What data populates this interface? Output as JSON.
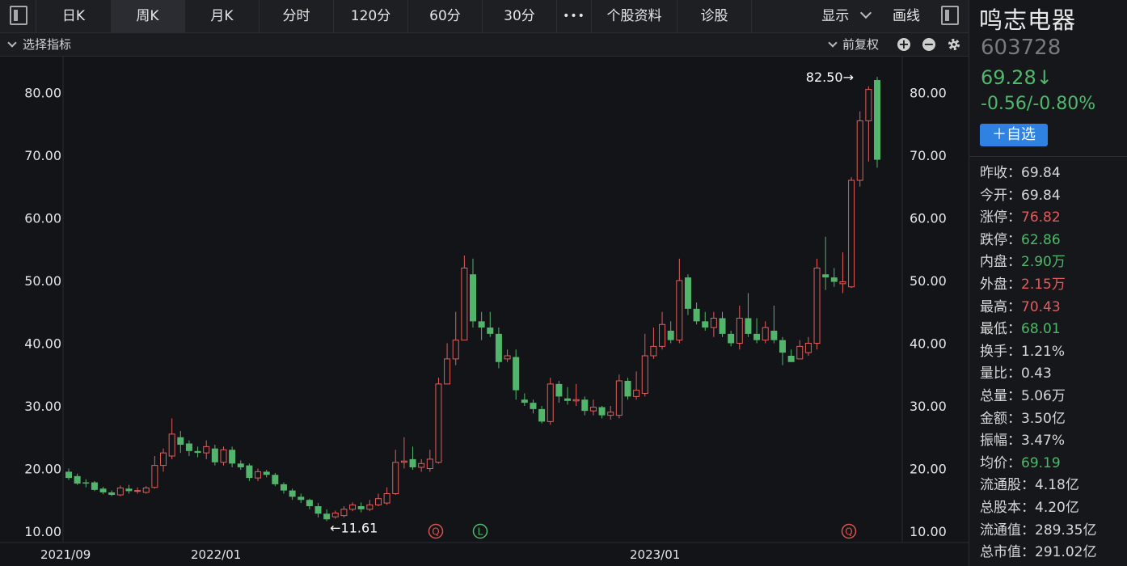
{
  "tabs": [
    {
      "label": "日K",
      "active": false
    },
    {
      "label": "周K",
      "active": true
    },
    {
      "label": "月K",
      "active": false
    },
    {
      "label": "分时",
      "active": false
    },
    {
      "label": "120分",
      "active": false
    },
    {
      "label": "60分",
      "active": false
    },
    {
      "label": "30分",
      "active": false
    },
    {
      "label": "•••",
      "active": false
    },
    {
      "label": "个股资料",
      "active": false
    },
    {
      "label": "诊股",
      "active": false
    }
  ],
  "toolbar": {
    "display_label": "显示",
    "draw_label": "画线"
  },
  "indicator_bar": {
    "select_label": "选择指标",
    "adjust_label": "前复权"
  },
  "colors": {
    "up": "#e25c5c",
    "down": "#52b56b",
    "accent": "#2f82e2",
    "background": "#131417"
  },
  "stock": {
    "name": "鸣志电器",
    "code": "603728",
    "price": "69.28↓",
    "change": "-0.56/-0.80%",
    "watch_label": "＋自选"
  },
  "stats": [
    {
      "label": "昨收：",
      "value": "69.84",
      "color": "#d8d8d8"
    },
    {
      "label": "今开：",
      "value": "69.84",
      "color": "#d8d8d8"
    },
    {
      "label": "涨停：",
      "value": "76.82",
      "color": "#e25c5c"
    },
    {
      "label": "跌停：",
      "value": "62.86",
      "color": "#4fb86b"
    },
    {
      "label": "内盘：",
      "value": "2.90万",
      "color": "#4fb86b"
    },
    {
      "label": "外盘：",
      "value": "2.15万",
      "color": "#e25c5c"
    },
    {
      "label": "最高：",
      "value": "70.43",
      "color": "#e25c5c"
    },
    {
      "label": "最低：",
      "value": "68.01",
      "color": "#4fb86b"
    },
    {
      "label": "换手：",
      "value": "1.21%",
      "color": "#d8d8d8"
    },
    {
      "label": "量比：",
      "value": "0.43",
      "color": "#d8d8d8"
    },
    {
      "label": "总量：",
      "value": "5.06万",
      "color": "#d8d8d8"
    },
    {
      "label": "金额：",
      "value": "3.50亿",
      "color": "#d8d8d8"
    },
    {
      "label": "振幅：",
      "value": "3.47%",
      "color": "#d8d8d8"
    },
    {
      "label": "均价：",
      "value": "69.19",
      "color": "#4fb86b"
    },
    {
      "label": "流通股：",
      "value": "4.18亿",
      "color": "#d8d8d8"
    },
    {
      "label": "总股本：",
      "value": "4.20亿",
      "color": "#d8d8d8"
    },
    {
      "label": "流通值：",
      "value": "289.35亿",
      "color": "#d8d8d8"
    },
    {
      "label": "总市值：",
      "value": "291.02亿",
      "color": "#d8d8d8"
    }
  ],
  "chart_data": {
    "type": "candlestick",
    "y_ticks": [
      "80.00",
      "70.00",
      "60.00",
      "50.00",
      "40.00",
      "30.00",
      "20.00",
      "10.00"
    ],
    "x_ticks": [
      "2021/09",
      "2022/01",
      "2023/01"
    ],
    "max_label": "82.50→",
    "min_label": "←11.61",
    "event_markers": [
      "Q",
      "L",
      "Q"
    ],
    "candles": [
      [
        19.5,
        18.5,
        20.0,
        18.2
      ],
      [
        18.8,
        17.6,
        19.2,
        17.4
      ],
      [
        17.8,
        17.6,
        18.3,
        17.0
      ],
      [
        17.8,
        16.6,
        18.0,
        16.4
      ],
      [
        16.8,
        16.2,
        17.1,
        15.9
      ],
      [
        16.2,
        15.8,
        16.5,
        15.6
      ],
      [
        15.8,
        16.9,
        17.3,
        15.6
      ],
      [
        16.8,
        16.4,
        17.4,
        16.0
      ],
      [
        16.5,
        16.5,
        17.0,
        16.0
      ],
      [
        16.2,
        16.9,
        17.2,
        16.0
      ],
      [
        17.0,
        20.5,
        22.0,
        16.8
      ],
      [
        20.5,
        22.5,
        23.2,
        19.5
      ],
      [
        22.0,
        25.5,
        28.0,
        21.5
      ],
      [
        25.0,
        23.8,
        26.0,
        22.5
      ],
      [
        24.0,
        22.8,
        24.5,
        22.0
      ],
      [
        22.8,
        22.5,
        23.5,
        21.8
      ],
      [
        22.5,
        23.5,
        24.5,
        21.5
      ],
      [
        23.2,
        21.0,
        23.8,
        20.5
      ],
      [
        21.0,
        23.0,
        23.5,
        20.5
      ],
      [
        23.0,
        20.8,
        23.5,
        20.2
      ],
      [
        20.8,
        20.2,
        21.3,
        19.8
      ],
      [
        20.5,
        18.5,
        20.8,
        18.0
      ],
      [
        18.5,
        19.5,
        20.0,
        18.0
      ],
      [
        19.5,
        19.0,
        19.8,
        18.6
      ],
      [
        19.0,
        17.5,
        19.3,
        17.2
      ],
      [
        17.5,
        16.5,
        17.8,
        16.0
      ],
      [
        16.5,
        15.5,
        16.8,
        15.0
      ],
      [
        15.5,
        15.0,
        16.0,
        14.5
      ],
      [
        15.0,
        14.0,
        15.2,
        13.5
      ],
      [
        14.0,
        12.8,
        14.5,
        12.2
      ],
      [
        12.8,
        11.9,
        13.5,
        11.61
      ],
      [
        12.3,
        12.9,
        13.3,
        12.0
      ],
      [
        12.5,
        13.5,
        14.0,
        12.2
      ],
      [
        13.5,
        14.2,
        14.6,
        13.2
      ],
      [
        14.0,
        13.5,
        14.6,
        13.0
      ],
      [
        13.5,
        14.2,
        15.0,
        13.2
      ],
      [
        14.2,
        15.2,
        16.0,
        14.0
      ],
      [
        14.5,
        16.0,
        17.0,
        14.2
      ],
      [
        16.0,
        21.0,
        23.0,
        15.8
      ],
      [
        21.0,
        21.2,
        25.0,
        20.0
      ],
      [
        21.5,
        20.2,
        23.5,
        19.8
      ],
      [
        20.2,
        20.8,
        21.5,
        19.5
      ],
      [
        20.0,
        21.5,
        23.0,
        19.5
      ],
      [
        21.0,
        33.5,
        34.5,
        20.8
      ],
      [
        33.5,
        37.5,
        40.0,
        33.5
      ],
      [
        37.5,
        40.5,
        45.0,
        36.5
      ],
      [
        40.5,
        52.0,
        54.0,
        40.5
      ],
      [
        51.0,
        43.5,
        53.5,
        42.5
      ],
      [
        43.5,
        42.5,
        45.0,
        40.5
      ],
      [
        42.5,
        41.5,
        45.0,
        41.0
      ],
      [
        41.5,
        37.0,
        42.5,
        36.0
      ],
      [
        37.5,
        38.0,
        39.0,
        37.0
      ],
      [
        37.8,
        32.5,
        39.0,
        31.0
      ],
      [
        31.0,
        30.5,
        32.0,
        30.0
      ],
      [
        30.5,
        29.5,
        31.0,
        28.8
      ],
      [
        29.5,
        27.5,
        30.0,
        27.2
      ],
      [
        27.5,
        33.5,
        34.5,
        27.0
      ],
      [
        33.5,
        31.5,
        34.0,
        30.5
      ],
      [
        31.2,
        30.8,
        33.0,
        30.2
      ],
      [
        30.8,
        31.0,
        33.5,
        30.0
      ],
      [
        31.0,
        29.2,
        31.5,
        28.5
      ],
      [
        29.2,
        29.8,
        31.0,
        28.5
      ],
      [
        29.8,
        28.5,
        30.0,
        28.0
      ],
      [
        28.5,
        29.0,
        30.0,
        27.8
      ],
      [
        28.5,
        34.0,
        35.0,
        28.0
      ],
      [
        34.0,
        31.5,
        34.5,
        31.0
      ],
      [
        31.5,
        32.5,
        35.5,
        31.0
      ],
      [
        32.0,
        38.0,
        41.5,
        31.5
      ],
      [
        38.0,
        39.5,
        42.5,
        37.5
      ],
      [
        39.5,
        43.0,
        45.0,
        39.0
      ],
      [
        42.0,
        40.5,
        43.5,
        40.0
      ],
      [
        40.5,
        50.0,
        53.5,
        40.0
      ],
      [
        50.5,
        45.5,
        51.0,
        44.5
      ],
      [
        45.5,
        43.5,
        46.5,
        43.0
      ],
      [
        43.5,
        42.5,
        45.0,
        42.0
      ],
      [
        42.5,
        44.0,
        45.0,
        41.0
      ],
      [
        44.0,
        41.5,
        45.0,
        41.0
      ],
      [
        41.5,
        40.0,
        42.0,
        39.5
      ],
      [
        40.0,
        44.0,
        46.0,
        39.0
      ],
      [
        44.0,
        41.5,
        48.0,
        41.0
      ],
      [
        41.5,
        40.5,
        44.0,
        40.0
      ],
      [
        40.5,
        42.5,
        43.5,
        40.0
      ],
      [
        42.0,
        40.5,
        46.0,
        40.0
      ],
      [
        40.5,
        38.5,
        41.0,
        36.5
      ],
      [
        38.0,
        37.0,
        39.0,
        37.0
      ],
      [
        37.5,
        39.5,
        40.5,
        37.5
      ],
      [
        38.5,
        40.0,
        41.0,
        38.0
      ],
      [
        40.0,
        52.0,
        53.5,
        39.0
      ],
      [
        51.0,
        50.5,
        57.0,
        48.5
      ],
      [
        50.5,
        49.8,
        52.0,
        49.0
      ],
      [
        49.5,
        49.8,
        54.5,
        48.0
      ],
      [
        49.0,
        66.0,
        66.5,
        48.8
      ],
      [
        66.0,
        75.5,
        77.0,
        65.0
      ],
      [
        75.5,
        80.5,
        81.0,
        69.0
      ],
      [
        82.0,
        69.28,
        82.5,
        68.01
      ]
    ]
  }
}
